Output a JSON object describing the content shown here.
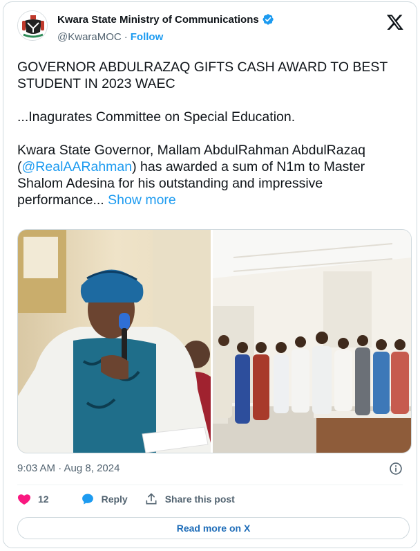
{
  "account": {
    "display_name": "Kwara State Ministry of Communications",
    "handle": "@KwaraMOC",
    "separator": "·",
    "follow_label": "Follow",
    "avatar_icon": "nigeria-coat-of-arms",
    "verified_icon": "verified-badge-icon",
    "platform_icon": "x-logo-icon"
  },
  "post": {
    "headline": "GOVERNOR ABDULRAZAQ GIFTS CASH AWARD TO BEST STUDENT IN 2023 WAEC",
    "subhead": "...Inagurates Committee on Special Education.",
    "body_prefix": "Kwara State Governor, Mallam AbdulRahman AbdulRazaq (",
    "mention": "@RealAARahman",
    "body_suffix": ") has awarded a sum of N1m to Master Shalom Adesina for his outstanding and impressive performance... ",
    "show_more_label": "Show more"
  },
  "meta": {
    "timestamp": "9:03 AM · Aug 8, 2024"
  },
  "actions": {
    "like_count": "12",
    "reply_label": "Reply",
    "share_label": "Share this post",
    "read_more_label": "Read more on X"
  },
  "colors": {
    "accent": "#1d9bf0",
    "like": "#f91880",
    "text": "#0f1419",
    "muted": "#536471",
    "border": "#cfd9de"
  }
}
